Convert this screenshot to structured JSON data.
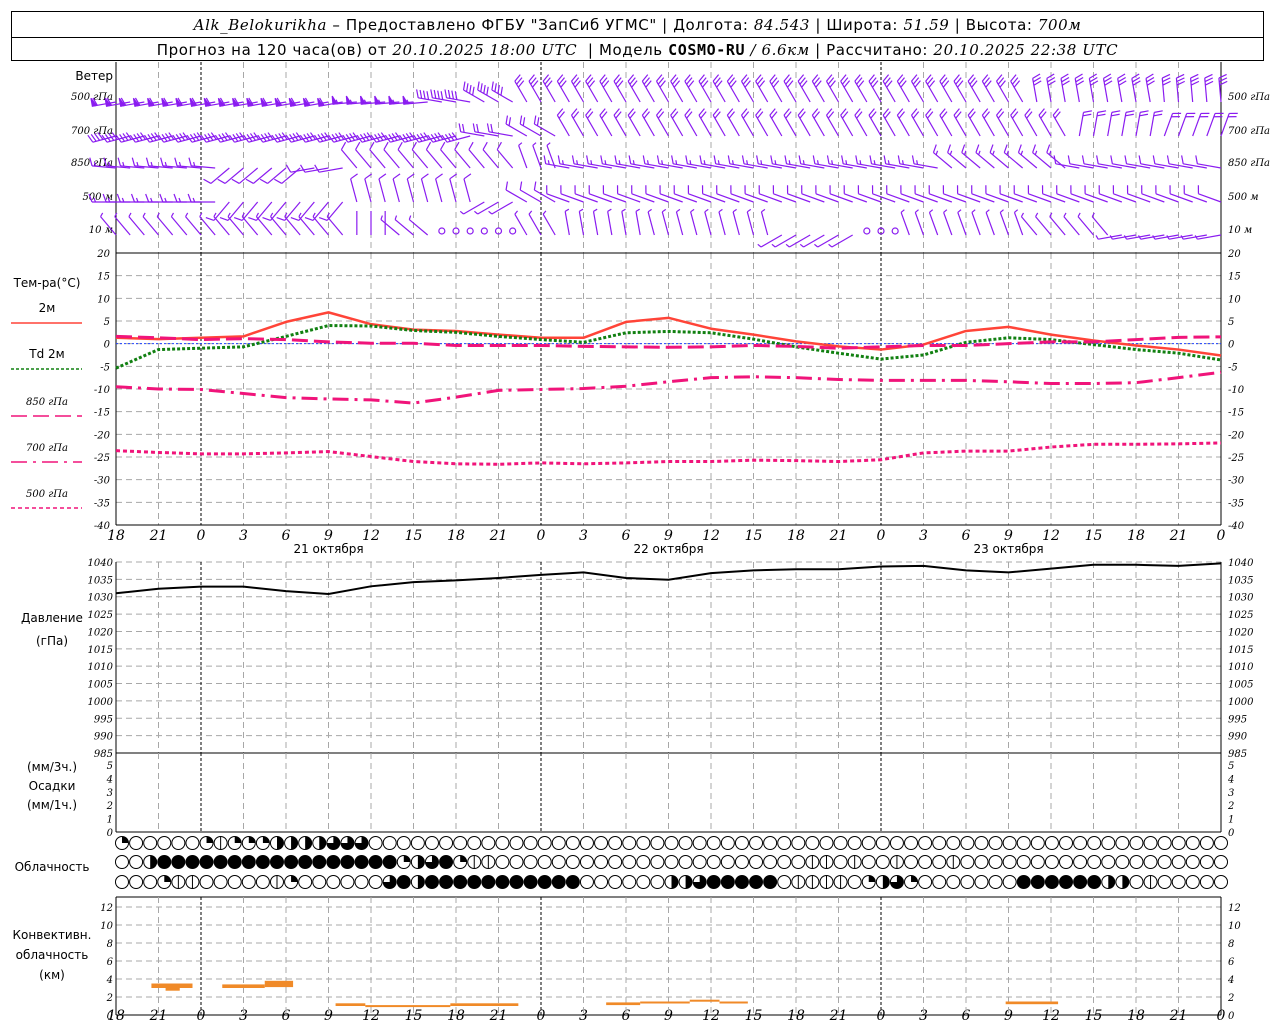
{
  "header": {
    "station": "Alk_Belokurikha",
    "provided_by": " – Предоставлено ФГБУ \"ЗапСиб УГМС\" | Долгота: ",
    "longitude": "84.543",
    "lat_label": " | Широта: ",
    "latitude": "51.59",
    "alt_label": " | Высота: ",
    "altitude": "700м",
    "forecast_label": "Прогноз на 120 часа(ов) от ",
    "forecast_start": "20.10.2025 18:00 UTC",
    "model_label": "  | Модель ",
    "model": "COSMO-RU",
    "resolution": " / 6.6км",
    "computed_label": " | Рассчитано: ",
    "computed_time": "20.10.2025 22:38 UTC"
  },
  "labels": {
    "wind": "Ветер",
    "wind_levels": [
      "500 гПа",
      "700 гПа",
      "850 гПа",
      "500 м",
      "10 м"
    ],
    "temperature": "Тем-ра(°C)",
    "pressure": [
      "Давление",
      "(гПа)"
    ],
    "precip": [
      "(мм/3ч.)",
      "Осадки",
      "(мм/1ч.)"
    ],
    "cloudiness": "Облачность",
    "convective": [
      "Конвективн.",
      "облачность",
      "(км)"
    ]
  },
  "colors": {
    "t2m": "#ff4438",
    "td2m": "#118011",
    "upper": "#f0147a",
    "zero_line": "#2244ff",
    "wind": "#8a1cf0",
    "convective": "#f08a28",
    "grid": "#a8a8a8"
  },
  "time_axis": {
    "hour_labels": [
      "18",
      "21",
      "0",
      "3",
      "6",
      "9",
      "12",
      "15",
      "18",
      "21",
      "0",
      "3",
      "6",
      "9",
      "12",
      "15",
      "18",
      "21",
      "0",
      "3",
      "6",
      "9",
      "12",
      "15",
      "18",
      "21",
      "0"
    ],
    "date_labels": [
      {
        "text": "21 октября",
        "at_hour": 15
      },
      {
        "text": "22 октября",
        "at_hour": 39
      },
      {
        "text": "23 октября",
        "at_hour": 63
      }
    ]
  },
  "chart_data": [
    {
      "type": "wind-barbs",
      "title": "Ветер",
      "x_hours_from_start": [
        0,
        3,
        6,
        9,
        12,
        15,
        18,
        21,
        24,
        27,
        30,
        33,
        36,
        39,
        42,
        45,
        48,
        51,
        54,
        57,
        60,
        63,
        66,
        69,
        72,
        75,
        78
      ],
      "units_dir_speed": "deg / m/s",
      "levels": [
        {
          "name": "500 гПа",
          "values": [
            [
              260,
              30
            ],
            [
              260,
              30
            ],
            [
              260,
              30
            ],
            [
              260,
              30
            ],
            [
              260,
              30
            ],
            [
              260,
              30
            ],
            [
              265,
              28
            ],
            [
              265,
              28
            ],
            [
              280,
              20
            ],
            [
              300,
              20
            ],
            [
              330,
              15
            ],
            [
              330,
              15
            ],
            [
              330,
              15
            ],
            [
              330,
              15
            ],
            [
              330,
              15
            ],
            [
              330,
              15
            ],
            [
              330,
              15
            ],
            [
              330,
              15
            ],
            [
              330,
              15
            ],
            [
              330,
              15
            ],
            [
              330,
              15
            ],
            [
              330,
              15
            ],
            [
              350,
              15
            ],
            [
              350,
              15
            ],
            [
              350,
              15
            ],
            [
              355,
              15
            ],
            [
              355,
              15
            ]
          ]
        },
        {
          "name": "700 гПа",
          "values": [
            [
              255,
              20
            ],
            [
              255,
              20
            ],
            [
              255,
              20
            ],
            [
              255,
              20
            ],
            [
              255,
              20
            ],
            [
              255,
              20
            ],
            [
              255,
              20
            ],
            [
              255,
              20
            ],
            [
              255,
              20
            ],
            [
              280,
              12
            ],
            [
              300,
              12
            ],
            [
              330,
              12
            ],
            [
              330,
              12
            ],
            [
              330,
              12
            ],
            [
              330,
              12
            ],
            [
              330,
              12
            ],
            [
              330,
              12
            ],
            [
              330,
              12
            ],
            [
              330,
              12
            ],
            [
              330,
              12
            ],
            [
              330,
              12
            ],
            [
              330,
              12
            ],
            [
              330,
              12
            ],
            [
              10,
              10
            ],
            [
              10,
              10
            ],
            [
              20,
              10
            ],
            [
              20,
              10
            ]
          ]
        },
        {
          "name": "850 гПа",
          "values": [
            [
              275,
              8
            ],
            [
              275,
              8
            ],
            [
              275,
              8
            ],
            [
              230,
              5
            ],
            [
              230,
              5
            ],
            [
              260,
              5
            ],
            [
              320,
              7
            ],
            [
              320,
              7
            ],
            [
              320,
              7
            ],
            [
              320,
              7
            ],
            [
              340,
              4
            ],
            [
              280,
              8
            ],
            [
              280,
              8
            ],
            [
              280,
              8
            ],
            [
              280,
              8
            ],
            [
              280,
              8
            ],
            [
              280,
              8
            ],
            [
              280,
              8
            ],
            [
              280,
              8
            ],
            [
              280,
              8
            ],
            [
              310,
              8
            ],
            [
              310,
              8
            ],
            [
              310,
              8
            ],
            [
              280,
              7
            ],
            [
              280,
              7
            ],
            [
              280,
              7
            ],
            [
              280,
              7
            ]
          ]
        },
        {
          "name": "500 м",
          "values": [
            [
              270,
              8
            ],
            [
              270,
              8
            ],
            [
              270,
              8
            ],
            [
              220,
              5
            ],
            [
              220,
              5
            ],
            [
              220,
              5
            ],
            [
              345,
              5
            ],
            [
              345,
              5
            ],
            [
              345,
              5
            ],
            [
              240,
              4
            ],
            [
              300,
              6
            ],
            [
              290,
              7
            ],
            [
              290,
              7
            ],
            [
              290,
              7
            ],
            [
              290,
              7
            ],
            [
              290,
              7
            ],
            [
              290,
              7
            ],
            [
              290,
              7
            ],
            [
              290,
              7
            ],
            [
              290,
              7
            ],
            [
              290,
              7
            ],
            [
              290,
              7
            ],
            [
              290,
              7
            ],
            [
              290,
              7
            ],
            [
              290,
              7
            ],
            [
              290,
              7
            ],
            [
              290,
              7
            ]
          ]
        },
        {
          "name": "10 м",
          "values": [
            [
              320,
              4
            ],
            [
              320,
              4
            ],
            [
              320,
              4
            ],
            [
              320,
              4
            ],
            [
              320,
              4
            ],
            [
              320,
              4
            ],
            [
              0,
              2
            ],
            [
              310,
              4
            ],
            [
              0,
              0
            ],
            [
              0,
              0
            ],
            [
              330,
              3
            ],
            [
              350,
              3
            ],
            [
              350,
              3
            ],
            [
              345,
              4
            ],
            [
              345,
              4
            ],
            [
              345,
              4
            ],
            [
              240,
              3
            ],
            [
              240,
              3
            ],
            [
              0,
              0
            ],
            [
              340,
              4
            ],
            [
              340,
              4
            ],
            [
              340,
              4
            ],
            [
              320,
              3
            ],
            [
              320,
              3
            ],
            [
              260,
              3
            ],
            [
              260,
              3
            ],
            [
              260,
              3
            ]
          ]
        }
      ]
    },
    {
      "type": "line",
      "title": "Тем-ра(°C)",
      "ylim": [
        -40,
        20
      ],
      "yticks": [
        20,
        15,
        10,
        5,
        0,
        -5,
        -10,
        -15,
        -20,
        -25,
        -30,
        -35,
        -40
      ],
      "grid": true,
      "x_hours_from_start": [
        0,
        3,
        6,
        9,
        12,
        15,
        18,
        21,
        24,
        27,
        30,
        33,
        36,
        39,
        42,
        45,
        48,
        51,
        54,
        57,
        60,
        63,
        66,
        69,
        72,
        75,
        78
      ],
      "series": [
        {
          "name": "2м",
          "style": "solid",
          "values": [
            1.3,
            1.0,
            1.3,
            1.6,
            4.8,
            6.9,
            4.3,
            3.1,
            2.8,
            2.0,
            1.3,
            1.3,
            4.8,
            5.7,
            3.3,
            2.0,
            0.5,
            -0.6,
            -1.3,
            -0.2,
            2.8,
            3.7,
            2.0,
            0.7,
            -0.4,
            -1.3,
            -2.6
          ]
        },
        {
          "name": "Td 2м",
          "style": "dotted",
          "values": [
            -5.4,
            -1.3,
            -1.0,
            -0.7,
            1.6,
            4.0,
            3.9,
            2.9,
            2.5,
            1.6,
            0.9,
            0.3,
            2.4,
            2.7,
            2.4,
            1.0,
            -0.7,
            -2.1,
            -3.4,
            -2.5,
            0.3,
            1.3,
            0.9,
            -0.2,
            -1.3,
            -2.1,
            -3.6
          ]
        },
        {
          "name": "850 гПа",
          "style": "longdash",
          "values": [
            1.6,
            1.3,
            0.9,
            1.1,
            0.9,
            0.4,
            0.1,
            0.1,
            -0.4,
            -0.4,
            -0.4,
            -0.6,
            -0.7,
            -0.8,
            -0.7,
            -0.4,
            -0.6,
            -1.0,
            -0.7,
            -0.4,
            -0.4,
            0.0,
            0.4,
            0.4,
            0.9,
            1.4,
            1.5
          ]
        },
        {
          "name": "700 гПа",
          "style": "dashdot",
          "values": [
            -9.5,
            -10.0,
            -10.1,
            -11.0,
            -11.9,
            -12.2,
            -12.4,
            -13.1,
            -11.8,
            -10.3,
            -10.1,
            -9.9,
            -9.4,
            -8.4,
            -7.5,
            -7.3,
            -7.5,
            -7.9,
            -8.1,
            -8.1,
            -8.1,
            -8.4,
            -8.8,
            -8.8,
            -8.6,
            -7.5,
            -6.3
          ]
        },
        {
          "name": "500 гПа",
          "style": "dashed",
          "values": [
            -23.6,
            -24.0,
            -24.3,
            -24.3,
            -24.1,
            -23.8,
            -24.9,
            -26.0,
            -26.5,
            -26.6,
            -26.3,
            -26.5,
            -26.3,
            -26.0,
            -26.0,
            -25.7,
            -25.8,
            -26.0,
            -25.6,
            -24.1,
            -23.7,
            -23.7,
            -22.8,
            -22.2,
            -22.2,
            -22.1,
            -21.9
          ]
        }
      ]
    },
    {
      "type": "line",
      "title": "Давление (гПа)",
      "ylim": [
        985,
        1040
      ],
      "yticks": [
        1040,
        1035,
        1030,
        1025,
        1020,
        1015,
        1010,
        1005,
        1000,
        995,
        990,
        985
      ],
      "grid": true,
      "x_hours_from_start": [
        0,
        3,
        6,
        9,
        12,
        15,
        18,
        21,
        24,
        27,
        30,
        33,
        36,
        39,
        42,
        45,
        48,
        51,
        54,
        57,
        60,
        63,
        66,
        69,
        72,
        75,
        78
      ],
      "series": [
        {
          "values": [
            1031.0,
            1032.3,
            1032.9,
            1032.9,
            1031.6,
            1030.8,
            1033.0,
            1034.2,
            1034.7,
            1035.4,
            1036.3,
            1037.0,
            1035.4,
            1034.9,
            1036.8,
            1037.6,
            1037.9,
            1037.9,
            1038.7,
            1038.9,
            1037.6,
            1037.0,
            1038.1,
            1039.2,
            1039.2,
            1038.9,
            1039.6
          ]
        }
      ]
    },
    {
      "type": "bar",
      "title": "Осадки",
      "ylim": [
        0,
        5
      ],
      "yticks": [
        5,
        4,
        3,
        2,
        1,
        0
      ],
      "values": []
    },
    {
      "type": "cloud-cover",
      "title": "Облачность",
      "units": "octas per hourly circle",
      "rows": [
        "2000002122244446660000000000000000000000000000000000000000000000000000000000000",
        "0048888888888888888824682110000000000000000000000110100100010000000000000000000",
        "0002110000012000000684888888888880000004468888801111024620000000888888440100000"
      ]
    },
    {
      "type": "range-bar",
      "title": "Конвективн. облачность (км)",
      "ylim": [
        0,
        13
      ],
      "yticks": [
        12,
        10,
        8,
        6,
        4,
        2,
        0
      ],
      "grid": true,
      "bars": [
        {
          "from_hour": 2.5,
          "to_hour": 5.4,
          "base_km": 3.0,
          "top_km": 3.5
        },
        {
          "from_hour": 3.5,
          "to_hour": 4.5,
          "base_km": 2.7,
          "top_km": 3.0
        },
        {
          "from_hour": 7.5,
          "to_hour": 10.5,
          "base_km": 3.0,
          "top_km": 3.4
        },
        {
          "from_hour": 10.5,
          "to_hour": 12.5,
          "base_km": 3.1,
          "top_km": 3.8
        },
        {
          "from_hour": 15.5,
          "to_hour": 17.6,
          "base_km": 1.0,
          "top_km": 1.3
        },
        {
          "from_hour": 17.6,
          "to_hour": 23.6,
          "base_km": 0.9,
          "top_km": 1.1
        },
        {
          "from_hour": 23.6,
          "to_hour": 28.4,
          "base_km": 1.0,
          "top_km": 1.3
        },
        {
          "from_hour": 34.6,
          "to_hour": 37.0,
          "base_km": 1.1,
          "top_km": 1.4
        },
        {
          "from_hour": 37.0,
          "to_hour": 40.5,
          "base_km": 1.3,
          "top_km": 1.5
        },
        {
          "from_hour": 40.5,
          "to_hour": 42.6,
          "base_km": 1.5,
          "top_km": 1.7
        },
        {
          "from_hour": 42.6,
          "to_hour": 44.6,
          "base_km": 1.3,
          "top_km": 1.5
        },
        {
          "from_hour": 62.8,
          "to_hour": 66.5,
          "base_km": 1.2,
          "top_km": 1.5
        }
      ]
    }
  ]
}
